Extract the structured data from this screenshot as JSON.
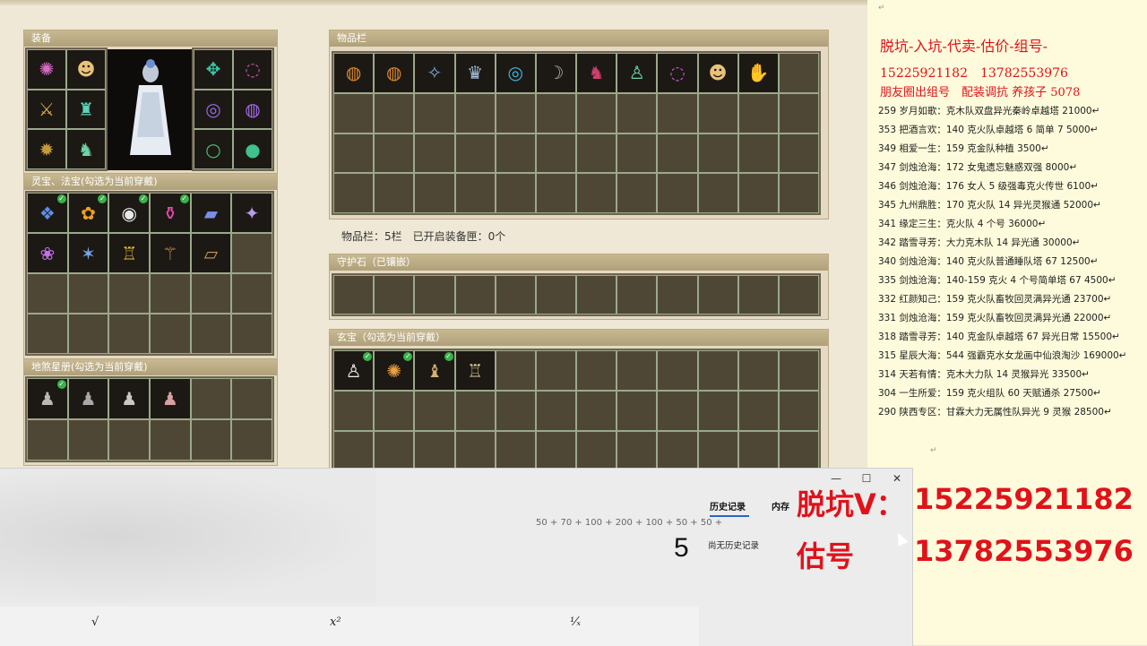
{
  "game": {
    "equip_title": "装备",
    "inventory_title": "物品栏",
    "lingbao_title": "灵宝、法宝(勾选为当前穿戴)",
    "dishai_title": "地煞星册(勾选为当前穿戴)",
    "guard_title": "守护石（已镶嵌）",
    "xuanbao_title": "玄宝（勾选为当前穿戴）",
    "inventory_info": "物品栏：5栏　已开启装备匣：0个"
  },
  "notes": {
    "mark": "↵",
    "header": "脱坑-入坑-代卖-估价-组号-",
    "phones": "15225921182　13782553976",
    "promo": "朋友圈出组号　配装调抗 养孩子 5078",
    "listings": [
      "259 岁月如歌：克木队双盘异光秦岭卓越塔 21000↵",
      "353 把酒言欢：140 克火队卓越塔 6 简单 7  5000↵",
      "349 相爱一生：159 克金队种植 3500↵",
      "347 剑烛沧海：172 女鬼遗忘魅惑双强 8000↵",
      "346 剑烛沧海：176 女人 5 级强毒克火传世 6100↵",
      "345 九州鼎胜：170 克火队 14 异光灵猴通 52000↵",
      "341 缘定三生：克火队 4 个号 36000↵",
      "342 踏雪寻芳：大力克木队 14 异光通 30000↵",
      "340 剑烛沧海：140 克火队普通睡队塔 67  12500↵",
      "335 剑烛沧海：140-159 克火 4 个号简单塔 67  4500↵",
      "332 红颜知己：159 克火队畜牧回灵满异光通 23700↵",
      "331 剑烛沧海：159 克火队畜牧回灵满异光通 22000↵",
      "318 踏雪寻芳：140 克金队卓越塔 67 异光日常 15500↵",
      "315 星辰大海：544 强霸克水女龙画中仙浪淘沙 169000↵",
      "314 天若有情：克木大力队 14 灵猴异光 33500↵",
      "304 一生所爱：159 克火组队 60 天赋通杀 27500↵",
      "290 陕西专区：甘霖大力无属性队异光 9 灵猴 28500↵"
    ]
  },
  "calculator": {
    "tab_history": "历史记录",
    "tab_memory": "内存",
    "expression": "50 + 70 + 100 + 200 + 100 + 50 + 50 +",
    "result": "5",
    "no_history": "尚无历史记录",
    "btn_minimize": "—",
    "btn_maximize": "☐",
    "btn_close": "✕",
    "fn_sqrt": "√",
    "fn_square": "x²",
    "fn_reciprocal": "¹⁄ₓ"
  },
  "overlay": {
    "line1_label": "脱坑V：",
    "line1_number": "15225921182",
    "line2_label": "估号",
    "line2_number": "13782553976"
  }
}
